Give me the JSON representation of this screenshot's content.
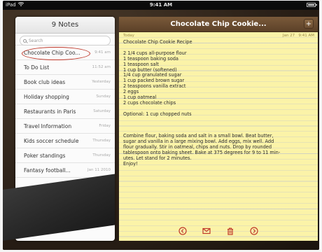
{
  "status_bar": {
    "device": "iPad",
    "time": "9:41 AM"
  },
  "list": {
    "title": "9 Notes",
    "search_placeholder": "Search",
    "items": [
      {
        "title": "Chocolate Chip Coo...",
        "date": "9:41 am"
      },
      {
        "title": "To Do List",
        "date": "11:52 am"
      },
      {
        "title": "Book club ideas",
        "date": "Yesterday"
      },
      {
        "title": "Holiday shopping",
        "date": "Sunday"
      },
      {
        "title": "Restaurants in Paris",
        "date": "Saturday"
      },
      {
        "title": "Travel Information",
        "date": "Friday"
      },
      {
        "title": "Kids soccer schedule",
        "date": "Thursday"
      },
      {
        "title": "Poker standings",
        "date": "Thursday"
      },
      {
        "title": "Fantasy football...",
        "date": "Jan 11 2010"
      }
    ]
  },
  "note": {
    "title": "Chocolate Chip Cookie...",
    "add_label": "+",
    "day_label": "Today",
    "date_label": "Jan 27",
    "time_label": "9:41 AM",
    "lines": [
      "Chocolate Chip Cookie Recipe",
      "",
      "2 1/4 cups all-purpose flour",
      "1 teaspoon baking soda",
      "1 teaspoon salt",
      "1 cup butter (softened)",
      "1/4 cup granulated sugar",
      "1 cup packed brown sugar",
      "2 teaspoons vanilla extract",
      "2 eggs",
      "1 cup oatmeal",
      "2 cups chocolate chips",
      "",
      "Optional: 1 cup chopped nuts",
      "",
      "",
      "",
      "Combine flour, baking soda and salt in a small bowl. Beat butter,",
      "sugar and vanilla in a large mixing bowl. Add eggs, mix well. Add",
      "flour gradually. Stir in oatmeal, chips and nuts. Drop by rounded",
      "tablespoon onto baking sheet. Bake at 375 degrees for 9 to 11 min-",
      "utes. Let stand for 2 minutes.",
      "Enjoy!"
    ]
  },
  "toolbar": {
    "icons": [
      "previous-icon",
      "mail-icon",
      "trash-icon",
      "next-icon"
    ]
  },
  "colors": {
    "paper": "#fbf3a8",
    "title_bar": "#6b4d30",
    "toolbar_icons": "#c0392b",
    "selection_circle": "#c0392b"
  }
}
